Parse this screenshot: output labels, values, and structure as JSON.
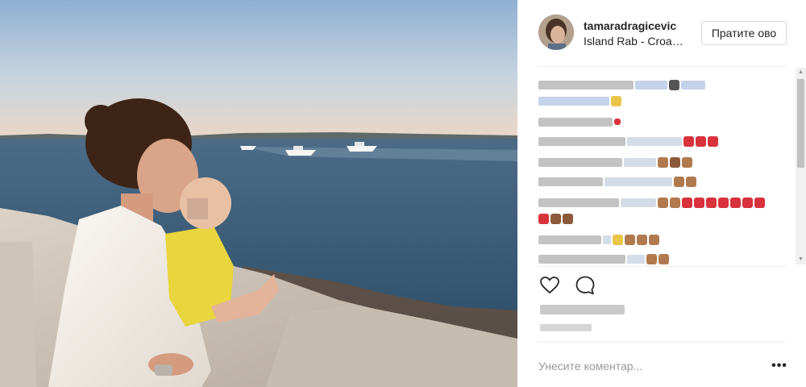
{
  "post": {
    "username": "tamaradragicevic",
    "location": "Island Rab - Croa…",
    "follow_label": "Пратите ово",
    "comment_placeholder": "Унесите коментар...",
    "more_label": "•••"
  },
  "icons": {
    "like": "heart-outline-icon",
    "comment": "comment-bubble-icon",
    "more": "ellipsis-icon",
    "scroll_up": "chevron-up-icon",
    "scroll_down": "chevron-down-icon"
  },
  "colors": {
    "border": "#dbdbdb",
    "text": "#262626",
    "muted": "#999999",
    "sky": "#a9c3dc",
    "sea": "#2f5270"
  }
}
